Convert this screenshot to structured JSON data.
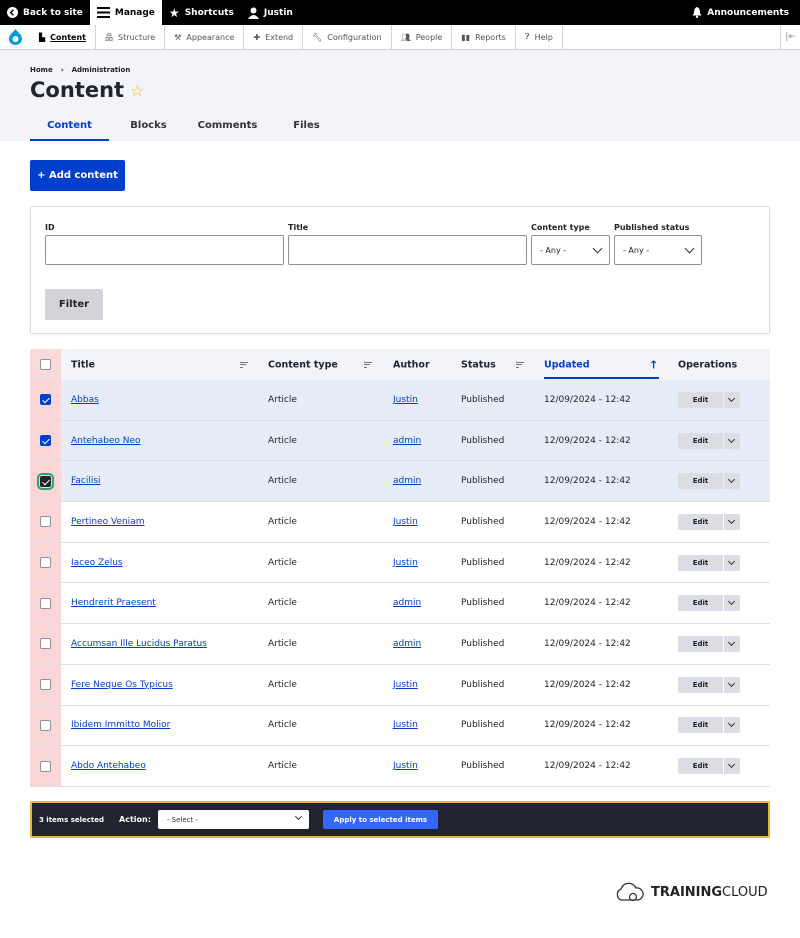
{
  "toolbar": {
    "back_to_site": "Back to site",
    "manage": "Manage",
    "shortcuts": "Shortcuts",
    "user": "Justin",
    "announcements": "Announcements"
  },
  "tray": {
    "items": [
      "Content",
      "Structure",
      "Appearance",
      "Extend",
      "Configuration",
      "People",
      "Reports",
      "Help"
    ]
  },
  "breadcrumb": [
    "Home",
    "›",
    "Administration"
  ],
  "page_title": "Content",
  "tabs": [
    "Content",
    "Blocks",
    "Comments",
    "Files"
  ],
  "add_content_label": "+ Add content",
  "filters": {
    "id_label": "ID",
    "title_label": "Title",
    "type_label": "Content type",
    "type_value": "- Any -",
    "status_label": "Published status",
    "status_value": "- Any -",
    "filter_button": "Filter"
  },
  "table": {
    "headers": [
      "Title",
      "Content type",
      "Author",
      "Status",
      "Updated",
      "Operations"
    ],
    "edit_label": "Edit",
    "rows": [
      {
        "title": "Abbas",
        "type": "Article",
        "author": "Justin",
        "status": "Published",
        "updated": "12/09/2024 - 12:42"
      },
      {
        "title": "Antehabeo Neo",
        "type": "Article",
        "author": "admin",
        "status": "Published",
        "updated": "12/09/2024 - 12:42"
      },
      {
        "title": "Facilisi",
        "type": "Article",
        "author": "admin",
        "status": "Published",
        "updated": "12/09/2024 - 12:42"
      },
      {
        "title": "Pertineo Veniam",
        "type": "Article",
        "author": "Justin",
        "status": "Published",
        "updated": "12/09/2024 - 12:42"
      },
      {
        "title": "Iaceo Zelus",
        "type": "Article",
        "author": "Justin",
        "status": "Published",
        "updated": "12/09/2024 - 12:42"
      },
      {
        "title": "Hendrerit Praesent",
        "type": "Article",
        "author": "admin",
        "status": "Published",
        "updated": "12/09/2024 - 12:42"
      },
      {
        "title": "Accumsan Ille Lucidus Paratus",
        "type": "Article",
        "author": "admin",
        "status": "Published",
        "updated": "12/09/2024 - 12:42"
      },
      {
        "title": "Fere Neque Os Typicus",
        "type": "Article",
        "author": "Justin",
        "status": "Published",
        "updated": "12/09/2024 - 12:42"
      },
      {
        "title": "Ibidem Immitto Molior",
        "type": "Article",
        "author": "Justin",
        "status": "Published",
        "updated": "12/09/2024 - 12:42"
      },
      {
        "title": "Abdo Antehabeo",
        "type": "Article",
        "author": "Justin",
        "status": "Published",
        "updated": "12/09/2024 - 12:42"
      }
    ]
  },
  "bulk": {
    "selected_text": "3 items selected",
    "action_label": "Action:",
    "select_value": "- Select -",
    "apply_label": "Apply to selected items"
  },
  "brand": {
    "part1": "TRAINING",
    "part2": "CLOUD"
  },
  "colors": {
    "accent": "#003ecc",
    "checkbox_column": "#fbd6d6",
    "selected_row": "#e6ecf8",
    "bulk_border": "#e5b832"
  }
}
